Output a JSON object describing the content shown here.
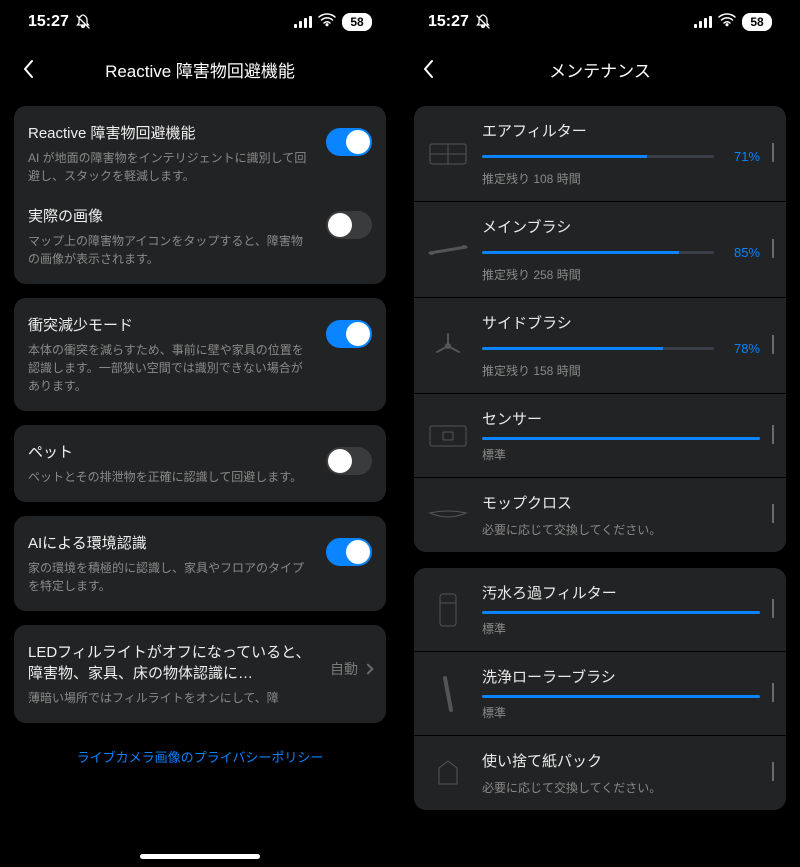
{
  "status": {
    "time": "15:27",
    "battery": "58"
  },
  "left": {
    "title": "Reactive 障害物回避機能",
    "settings": {
      "reactive": {
        "title": "Reactive 障害物回避機能",
        "desc": "AI が地面の障害物をインテリジェントに識別して回避し、スタックを軽減します。"
      },
      "realImage": {
        "title": "実際の画像",
        "desc": "マップ上の障害物アイコンをタップすると、障害物の画像が表示されます。"
      },
      "collision": {
        "title": "衝突減少モード",
        "desc": "本体の衝突を減らすため、事前に壁や家具の位置を認識します。一部狭い空間では識別できない場合があります。"
      },
      "pet": {
        "title": "ペット",
        "desc": "ペットとその排泄物を正確に認識して回避します。"
      },
      "aiEnv": {
        "title": "AIによる環境認識",
        "desc": "家の環境を積極的に認識し、家具やフロアのタイプを特定します。"
      },
      "led": {
        "title": "LEDフィルライトがオフになっていると、障害物、家具、床の物体認識に…",
        "desc": "薄暗い場所ではフィルライトをオンにして、障",
        "value": "自動"
      }
    },
    "footerLink": "ライブカメラ画像のプライバシーポリシー"
  },
  "right": {
    "title": "メンテナンス",
    "items": {
      "filter": {
        "title": "エアフィルター",
        "pct": 71,
        "pctLabel": "71%",
        "sub": "推定残り 108 時間"
      },
      "mainBrush": {
        "title": "メインブラシ",
        "pct": 85,
        "pctLabel": "85%",
        "sub": "推定残り 258 時間"
      },
      "sideBrush": {
        "title": "サイドブラシ",
        "pct": 78,
        "pctLabel": "78%",
        "sub": "推定残り 158 時間"
      },
      "sensor": {
        "title": "センサー",
        "pct": 100,
        "sub": "標準"
      },
      "mop": {
        "title": "モップクロス",
        "sub": "必要に応じて交換してください。"
      },
      "dirtyFilter": {
        "title": "汚水ろ過フィルター",
        "pct": 100,
        "sub": "標準"
      },
      "washRoller": {
        "title": "洗浄ローラーブラシ",
        "pct": 100,
        "sub": "標準"
      },
      "dustBag": {
        "title": "使い捨て紙パック",
        "sub": "必要に応じて交換してください。"
      }
    }
  }
}
